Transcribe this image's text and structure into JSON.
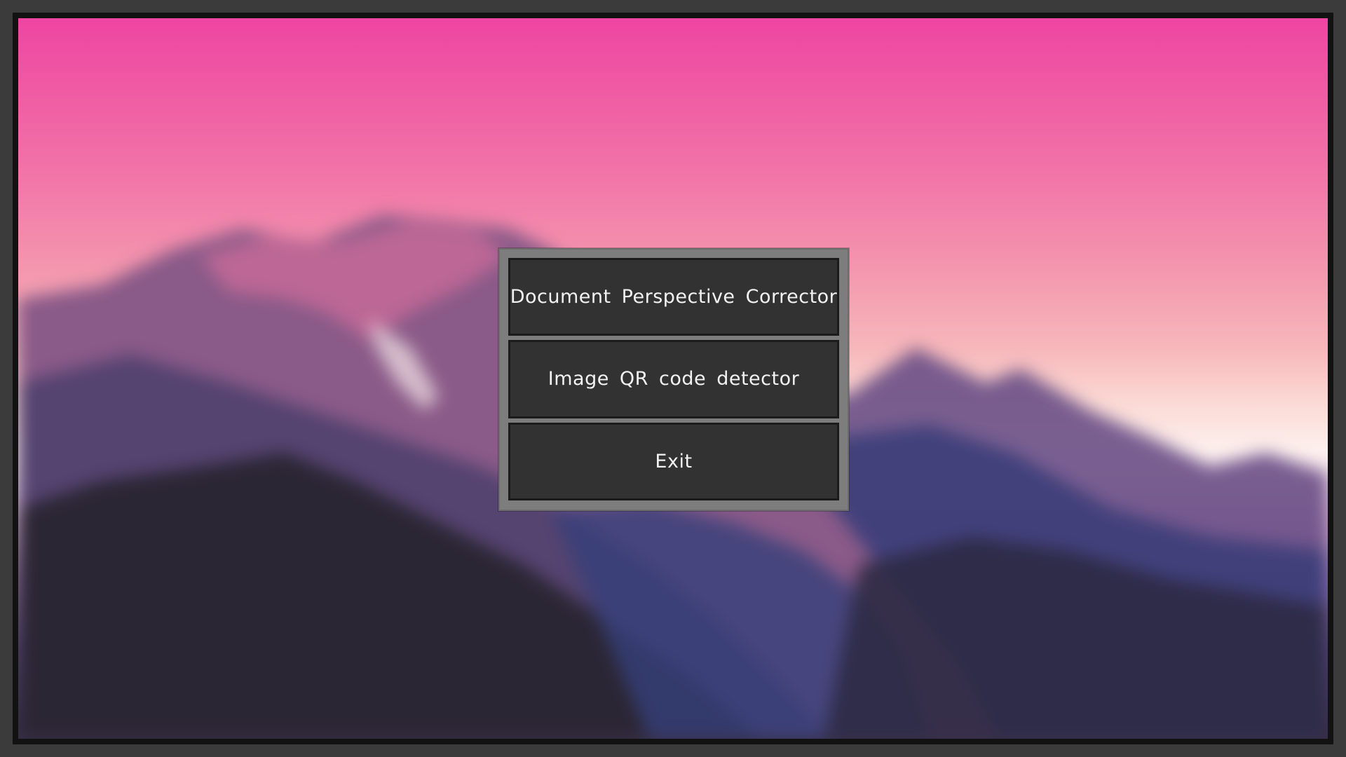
{
  "menu": {
    "items": [
      {
        "label": "Document Perspective Corrector"
      },
      {
        "label": "Image QR code detector"
      },
      {
        "label": "Exit"
      }
    ]
  },
  "background": {
    "description_color_top": "#ee45a2",
    "description_color_horizon": "#fdf0ee",
    "mountain_color": "#3a3048"
  }
}
